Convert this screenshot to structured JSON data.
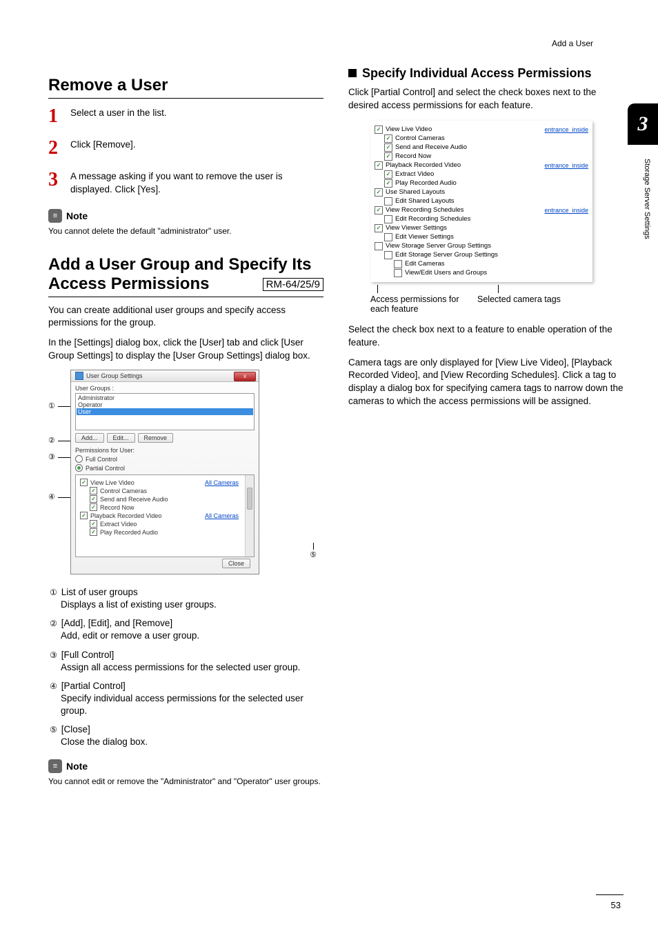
{
  "header": {
    "breadcrumb": "Add a User"
  },
  "side": {
    "chapter": "3",
    "caption": "Storage Server Settings"
  },
  "left": {
    "h_remove": "Remove a User",
    "step1": "Select a user in the list.",
    "step2": "Click [Remove].",
    "step3": "A message asking if you want to remove the user is displayed. Click [Yes].",
    "note_label": "Note",
    "note1": "You cannot delete the default \"administrator\" user.",
    "h_addgroup": "Add a User Group and Specify Its Access Permissions",
    "tag_rm": "RM-64/25/9",
    "p_add1": "You can create additional user groups and specify access permissions for the group.",
    "p_add2": "In the [Settings] dialog box, click the [User] tab and click [User Group Settings] to display the [User Group Settings] dialog box.",
    "callouts": [
      {
        "n": "①",
        "title": "List of user groups",
        "desc": "Displays a list of existing user groups."
      },
      {
        "n": "②",
        "title": "[Add], [Edit], and [Remove]",
        "desc": "Add, edit or remove a user group."
      },
      {
        "n": "③",
        "title": "[Full Control]",
        "desc": "Assign all access permissions for the selected user group."
      },
      {
        "n": "④",
        "title": "[Partial Control]",
        "desc": "Specify individual access permissions for the selected user group."
      },
      {
        "n": "⑤",
        "title": "[Close]",
        "desc": "Close the dialog box."
      }
    ],
    "note2": "You cannot edit or remove the \"Administrator\" and \"Operator\" user groups.",
    "ugs": {
      "title": "User Group Settings",
      "close_x": "x",
      "groups_label": "User Groups :",
      "groups": [
        "Administrator",
        "Operator",
        "User"
      ],
      "btn_add": "Add...",
      "btn_edit": "Edit...",
      "btn_remove": "Remove",
      "perm_label": "Permissions for User:",
      "radio_full": "Full Control",
      "radio_partial": "Partial Control",
      "perm_items": [
        {
          "label": "View Live Video",
          "ind": 0,
          "on": true,
          "link": "All Cameras"
        },
        {
          "label": "Control Cameras",
          "ind": 1,
          "on": true
        },
        {
          "label": "Send and Receive Audio",
          "ind": 1,
          "on": true
        },
        {
          "label": "Record Now",
          "ind": 1,
          "on": true
        },
        {
          "label": "Playback Recorded Video",
          "ind": 0,
          "on": true,
          "link": "All Cameras"
        },
        {
          "label": "Extract Video",
          "ind": 1,
          "on": true
        },
        {
          "label": "Play Recorded Audio",
          "ind": 1,
          "on": true
        }
      ],
      "btn_close": "Close"
    }
  },
  "right": {
    "h_specify": "Specify Individual Access Permissions",
    "p1": "Click [Partial Control] and select the check boxes next to the desired access permissions for each feature.",
    "perm_items": [
      {
        "label": "View Live Video",
        "ind": 0,
        "on": true,
        "tag": "entrance_inside"
      },
      {
        "label": "Control Cameras",
        "ind": 1,
        "on": true
      },
      {
        "label": "Send and Receive Audio",
        "ind": 1,
        "on": true
      },
      {
        "label": "Record Now",
        "ind": 1,
        "on": true
      },
      {
        "label": "Playback Recorded Video",
        "ind": 0,
        "on": true,
        "tag": "entrance_inside"
      },
      {
        "label": "Extract Video",
        "ind": 1,
        "on": true
      },
      {
        "label": "Play Recorded Audio",
        "ind": 1,
        "on": true
      },
      {
        "label": "Use Shared Layouts",
        "ind": 0,
        "on": true
      },
      {
        "label": "Edit Shared Layouts",
        "ind": 1,
        "on": false
      },
      {
        "label": "View Recording Schedules",
        "ind": 0,
        "on": true,
        "tag": "entrance_inside"
      },
      {
        "label": "Edit Recording Schedules",
        "ind": 1,
        "on": false
      },
      {
        "label": "View Viewer Settings",
        "ind": 0,
        "on": true
      },
      {
        "label": "Edit Viewer Settings",
        "ind": 1,
        "on": false
      },
      {
        "label": "View Storage Server Group Settings",
        "ind": 0,
        "on": false
      },
      {
        "label": "Edit Storage Server Group Settings",
        "ind": 1,
        "on": false
      },
      {
        "label": "Edit Cameras",
        "ind": 2,
        "on": false
      },
      {
        "label": "View/Edit Users and Groups",
        "ind": 2,
        "on": false
      }
    ],
    "cap_a": "Access permissions for each feature",
    "cap_b": "Selected camera tags",
    "p2": "Select the check box next to a feature to enable operation of the feature.",
    "p3": "Camera tags are only displayed for [View Live Video], [Playback Recorded Video], and [View Recording Schedules]. Click a tag to display a dialog box for specifying camera tags to narrow down the cameras to which the access permissions will be assigned."
  },
  "footer": {
    "pageno": "53"
  }
}
